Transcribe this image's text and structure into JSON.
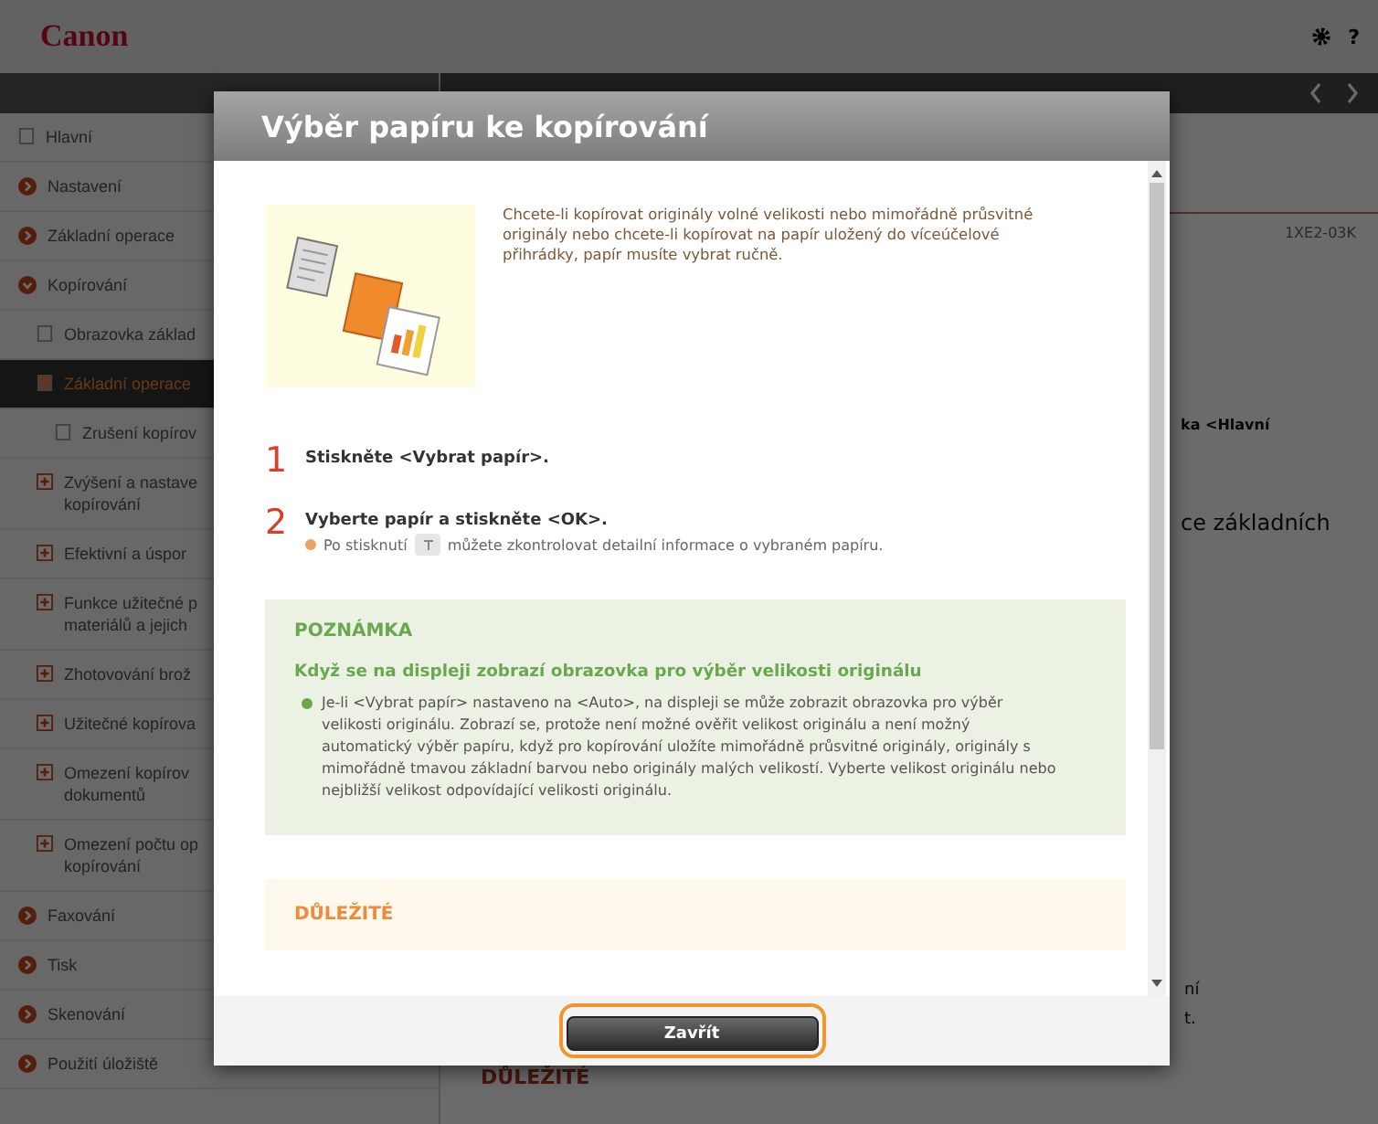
{
  "header": {
    "logo": "Canon",
    "help_label": "?"
  },
  "sidebar": {
    "items": [
      {
        "kind": "page",
        "lines": [
          "Hlavní"
        ],
        "selected": false
      },
      {
        "kind": "section",
        "lines": [
          "Nastavení"
        ],
        "expanded": false,
        "selected": false
      },
      {
        "kind": "section",
        "lines": [
          "Základní operace"
        ],
        "expanded": false,
        "selected": false
      },
      {
        "kind": "section",
        "lines": [
          "Kopírování"
        ],
        "expanded": true,
        "selected": false,
        "children": [
          {
            "kind": "page",
            "lines": [
              "Obrazovka základ"
            ],
            "selected": false
          },
          {
            "kind": "page",
            "lines": [
              "Základní operace"
            ],
            "selected": true,
            "children": [
              {
                "kind": "page",
                "lines": [
                  "Zrušení kopírov"
                ],
                "selected": false
              }
            ]
          },
          {
            "kind": "topic",
            "lines": [
              "Zvýšení a nastave",
              "kopírování"
            ],
            "selected": false
          },
          {
            "kind": "topic",
            "lines": [
              "Efektivní a úspor"
            ],
            "selected": false
          },
          {
            "kind": "topic",
            "lines": [
              "Funkce užitečné p",
              "materiálů a jejich"
            ],
            "selected": false
          },
          {
            "kind": "topic",
            "lines": [
              "Zhotovování brož"
            ],
            "selected": false
          },
          {
            "kind": "topic",
            "lines": [
              "Užitečné kopírova"
            ],
            "selected": false
          },
          {
            "kind": "topic",
            "lines": [
              "Omezení kopírov",
              "dokumentů"
            ],
            "selected": false
          },
          {
            "kind": "topic",
            "lines": [
              "Omezení počtu op",
              "kopírování"
            ],
            "selected": false
          }
        ]
      },
      {
        "kind": "section",
        "lines": [
          "Faxování"
        ],
        "expanded": false,
        "selected": false
      },
      {
        "kind": "section",
        "lines": [
          "Tisk"
        ],
        "expanded": false,
        "selected": false
      },
      {
        "kind": "section",
        "lines": [
          "Skenování"
        ],
        "expanded": false,
        "selected": false
      },
      {
        "kind": "section",
        "lines": [
          "Použití úložiště"
        ],
        "expanded": false,
        "selected": false
      }
    ]
  },
  "main": {
    "doc_code": "1XE2-03K",
    "fragment_1": "ka <Hlavní",
    "fragment_2": "ce základních",
    "fragment_3": "ní",
    "fragment_4": "t.",
    "important": "DŮLEŽITÉ"
  },
  "dialog": {
    "title": "Výběr papíru ke kopírování",
    "intro": "Chcete-li kopírovat originály volné velikosti nebo mimořádně průsvitné originály nebo chcete-li kopírovat na papír uložený do víceúčelové přihrádky, papír musíte vybrat ručně.",
    "steps": [
      {
        "number": "1",
        "text": "Stiskněte <Vybrat papír>."
      },
      {
        "number": "2",
        "text": "Vyberte papír a stiskněte <OK>.",
        "note_before": "Po stisknutí",
        "note_after": "můžete zkontrolovat detailní informace o vybraném papíru."
      }
    ],
    "note": {
      "heading": "POZNÁMKA",
      "subheading": "Když se na displeji zobrazí obrazovka pro výběr velikosti originálu",
      "bullets": [
        "Je-li <Vybrat papír> nastaveno na <Auto>, na displeji se může zobrazit obrazovka pro výběr velikosti originálu. Zobrazí se, protože není možné ověřit velikost originálu a není možný automatický výběr papíru, když pro kopírování uložíte mimořádně průsvitné originály, originály s mimořádně tmavou základní barvou nebo originály malých velikostí. Vyberte velikost originálu nebo nejbližší velikost odpovídající velikosti originálu."
      ]
    },
    "important": {
      "heading": "DŮLEŽITÉ"
    },
    "close_button": "Zavřít"
  }
}
